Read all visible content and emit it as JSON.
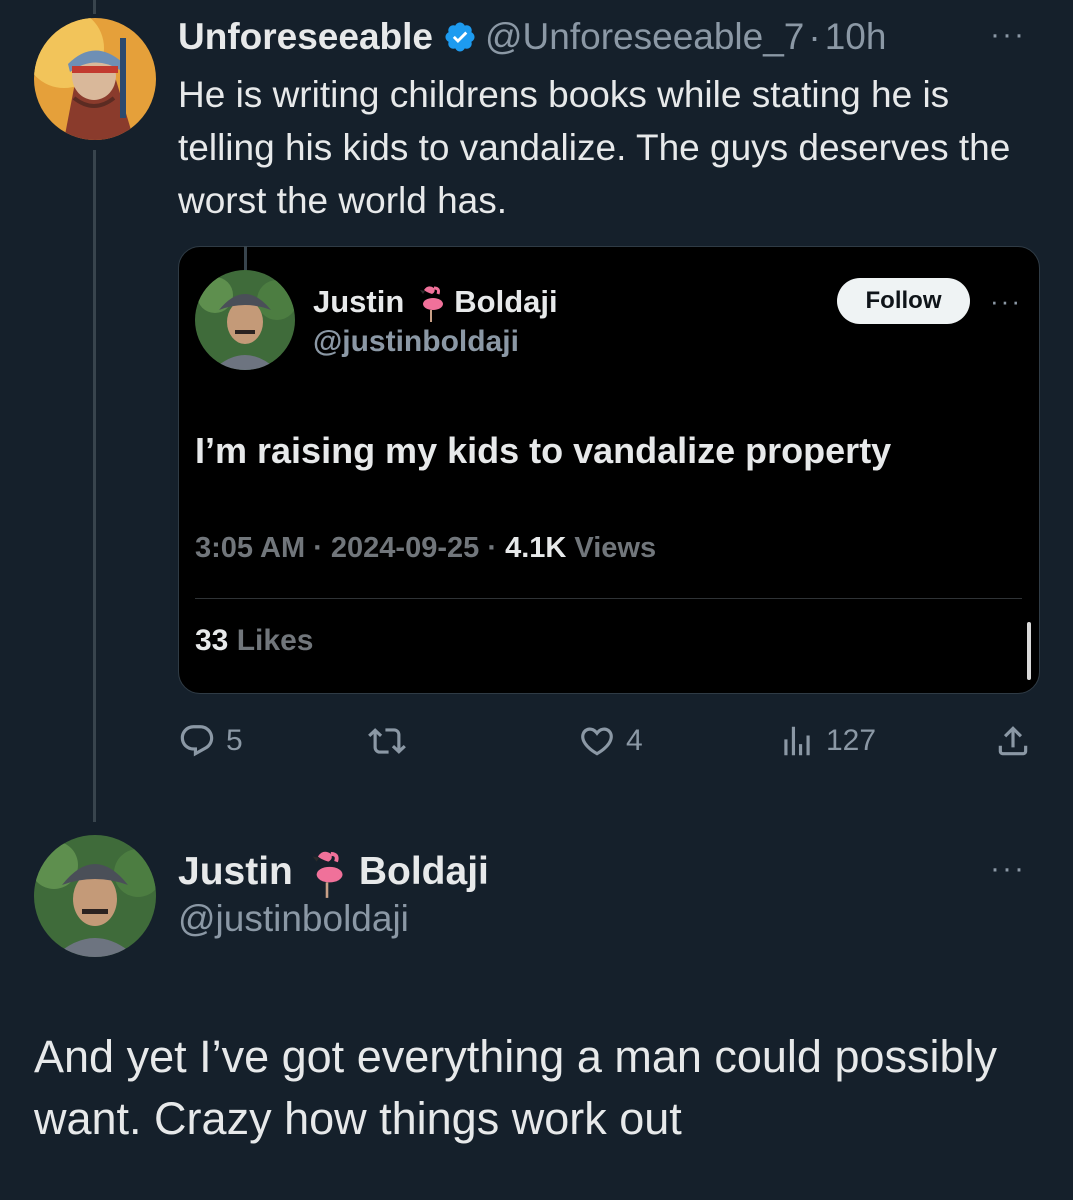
{
  "reply_tweet": {
    "author_name": "Unforeseeable",
    "author_handle": "@Unforeseeable_7",
    "time_separator": "·",
    "time_ago": "10h",
    "more_icon": "···",
    "text": "He is writing childrens books while stating he is telling his kids to vandalize. The guys deserves the worst the world has.",
    "verified": true,
    "accent_color": "#1d9bf0"
  },
  "quoted_tweet": {
    "author_first": "Justin",
    "author_last": "Boldaji",
    "author_handle": "@justinboldaji",
    "follow_label": "Follow",
    "more_icon": "···",
    "text": "I’m raising my kids to vandalize property",
    "time": "3:05 AM",
    "sep": "·",
    "date": "2024-09-25",
    "views_count": "4.1K",
    "views_label": "Views",
    "likes_count": "33",
    "likes_label": "Likes"
  },
  "actions": {
    "reply_icon": "reply-icon",
    "reply_count": "5",
    "retweet_icon": "retweet-icon",
    "like_icon": "heart-icon",
    "like_count": "4",
    "views_icon": "views-icon",
    "views_count": "127",
    "share_icon": "share-icon"
  },
  "main_tweet": {
    "author_first": "Justin",
    "author_last": "Boldaji",
    "author_handle": "@justinboldaji",
    "more_icon": "···",
    "text": "And yet I’ve got everything a man could possibly want. Crazy how things work out"
  },
  "colors": {
    "background": "#15202b",
    "text": "#e7e9ea",
    "muted": "#8b98a5",
    "quote_bg": "#000000"
  }
}
